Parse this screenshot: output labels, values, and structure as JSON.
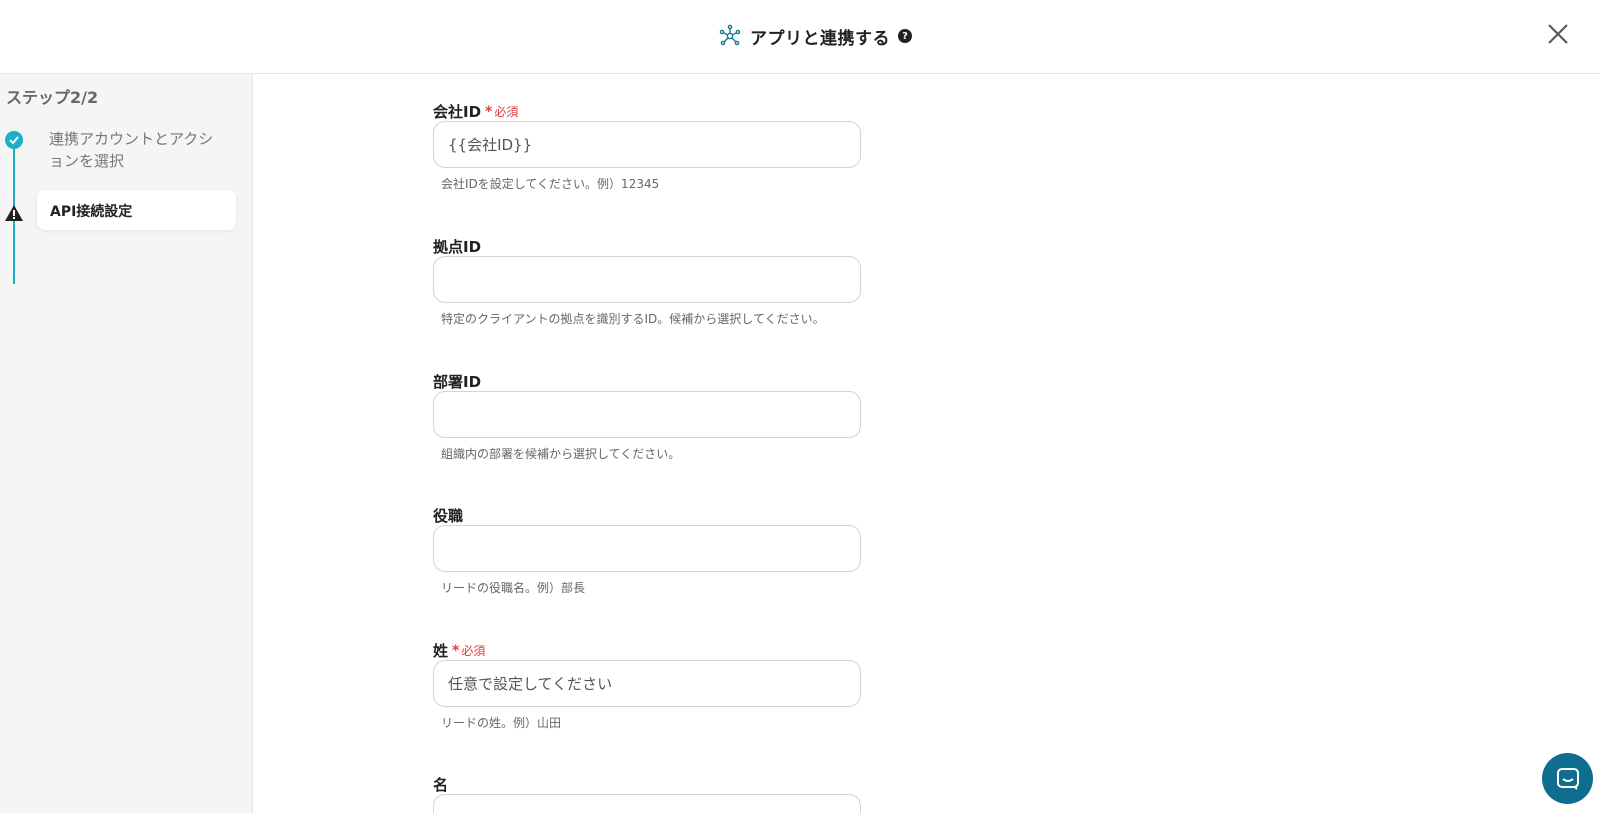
{
  "header": {
    "title": "アプリと連携する",
    "help_icon": "?",
    "app_icon": "network-node-icon",
    "close_icon": "close-icon"
  },
  "sidebar": {
    "step_count": "ステップ2/2",
    "steps": [
      {
        "label": "連携アカウントとアクションを選択",
        "status": "done",
        "icon": "check-circle-icon"
      },
      {
        "label": "API接続設定",
        "status": "warning",
        "icon": "warning-icon"
      }
    ]
  },
  "form": {
    "required_mark": "*",
    "required_text": "必須",
    "fields": [
      {
        "label": "会社ID",
        "required": true,
        "value": "{{会社ID}}",
        "hint": "会社IDを設定してください。例）12345"
      },
      {
        "label": "拠点ID",
        "required": false,
        "value": "",
        "hint": "特定のクライアントの拠点を識別するID。候補から選択してください。"
      },
      {
        "label": "部署ID",
        "required": false,
        "value": "",
        "hint": "組織内の部署を候補から選択してください。"
      },
      {
        "label": "役職",
        "required": false,
        "value": "",
        "hint": "リードの役職名。例）部長"
      },
      {
        "label": "姓",
        "required": true,
        "value": "任意で設定してください",
        "hint": "リードの姓。例）山田"
      },
      {
        "label": "名",
        "required": false,
        "value": "",
        "hint": ""
      }
    ]
  },
  "colors": {
    "accent": "#1cb0c8",
    "required": "#e53935",
    "chat_button": "#0f6e8f"
  }
}
